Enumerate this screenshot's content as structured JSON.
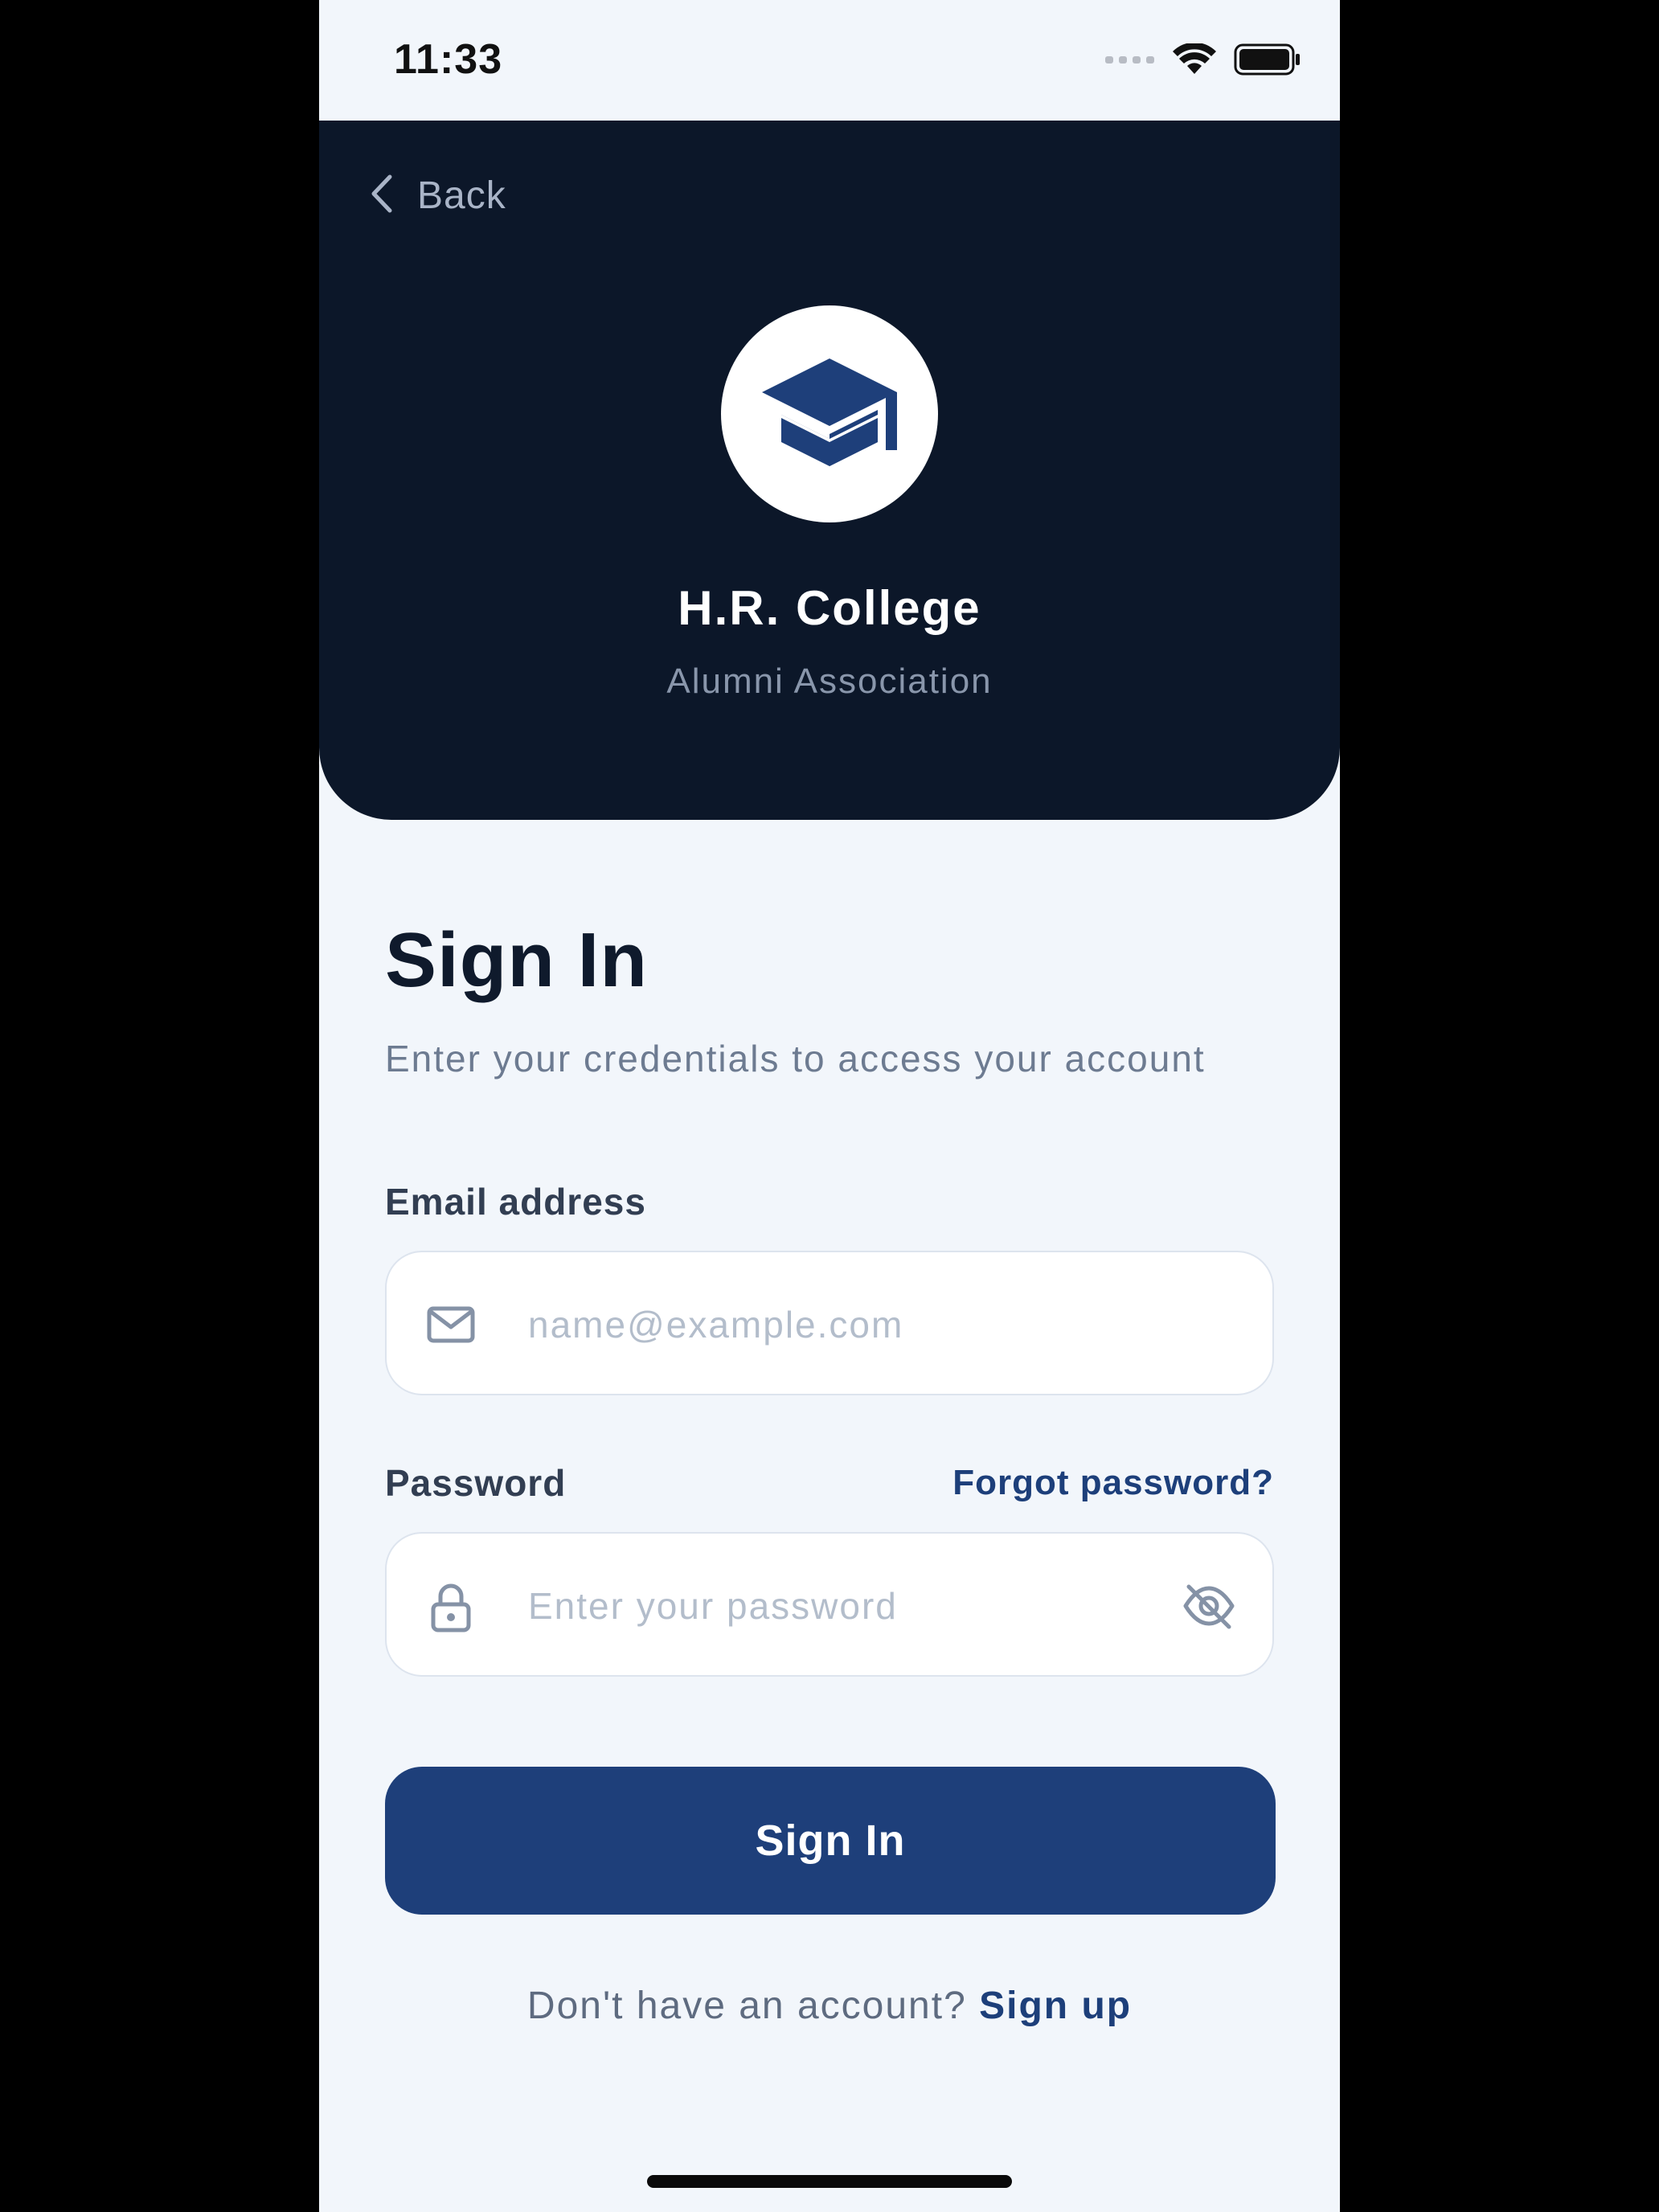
{
  "status_bar": {
    "time": "11:33"
  },
  "header": {
    "back_label": "Back",
    "college_name": "H.R. College",
    "college_subtitle": "Alumni Association",
    "logo_icon": "graduation-cap-icon"
  },
  "form": {
    "title": "Sign In",
    "subtitle": "Enter your credentials to access your account",
    "email": {
      "label": "Email address",
      "value": "",
      "placeholder": "name@example.com",
      "icon": "mail-icon"
    },
    "password": {
      "label": "Password",
      "value": "",
      "placeholder": "Enter your password",
      "icon": "lock-icon",
      "toggle_icon": "eye-off-icon",
      "forgot_label": "Forgot password?"
    },
    "submit_label": "Sign In",
    "signup_prompt": "Don't have an account?",
    "signup_link": "Sign up"
  },
  "colors": {
    "header_bg": "#0c1729",
    "page_bg": "#f2f6fb",
    "accent": "#1e3f7a",
    "title_text": "#0f1a2c",
    "muted_text": "#6d7b91"
  }
}
